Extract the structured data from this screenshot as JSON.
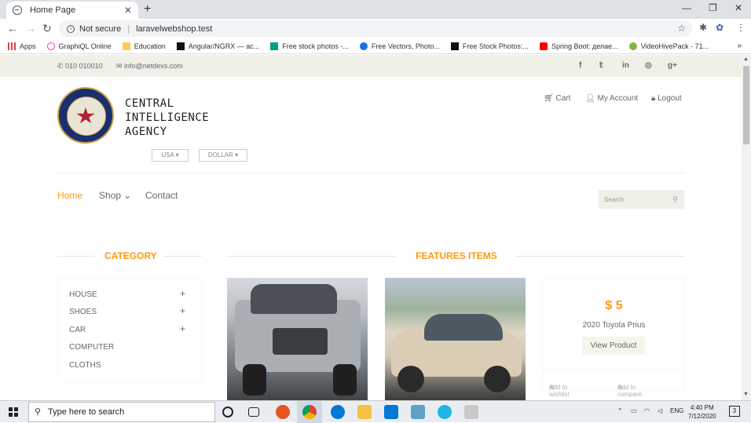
{
  "browser": {
    "tab_title": "Home Page",
    "url": "laravelwebshop.test",
    "security_label": "Not secure",
    "bookmarks": [
      {
        "label": "Apps"
      },
      {
        "label": "GraphiQL Online"
      },
      {
        "label": "Education"
      },
      {
        "label": "Angular/NGRX — ac..."
      },
      {
        "label": "Free stock photos -..."
      },
      {
        "label": "Free Vectors, Photo..."
      },
      {
        "label": "Free Stock Photos:..."
      },
      {
        "label": "Spring Boot: делае..."
      },
      {
        "label": "VideoHivePack - 71..."
      }
    ]
  },
  "topbar": {
    "phone": "010 010010",
    "email": "info@netdevs.com"
  },
  "header": {
    "agency_line1": "CENTRAL",
    "agency_line2": "INTELLIGENCE",
    "agency_line3": "AGENCY",
    "country": "USA",
    "currency": "DOLLAR",
    "cart": "Cart",
    "my_account": "My Account",
    "logout": "Logout"
  },
  "menu": {
    "home": "Home",
    "shop": "Shop",
    "contact": "Contact",
    "search_placeholder": "Search"
  },
  "category": {
    "title": "CATEGORY",
    "items": [
      "HOUSE",
      "SHOES",
      "CAR",
      "COMPUTER",
      "CLOTHS"
    ]
  },
  "features": {
    "title": "FEATURES ITEMS",
    "product": {
      "price": "$ 5",
      "name": "2020 Toyota Prius",
      "view": "View Product",
      "wishlist": "Add to wishlist",
      "compare": "Add to compare"
    }
  },
  "taskbar": {
    "search_placeholder": "Type here to search",
    "language": "ENG",
    "time": "4:40 PM",
    "date": "7/12/2020",
    "notifications": "3"
  },
  "colors": {
    "accent": "#fe980f",
    "text": "#696763"
  }
}
